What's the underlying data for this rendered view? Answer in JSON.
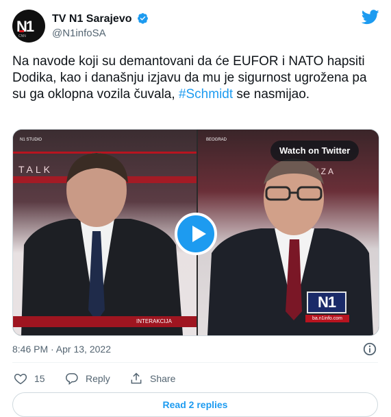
{
  "account": {
    "name": "TV N1 Sarajevo",
    "handle": "@N1infoSA",
    "avatar_text": "N1",
    "avatar_subtext": "CNN"
  },
  "tweet": {
    "text_before": "Na navode koji su demantovani da će EUFOR i NATO hapsiti Dodika, kao i današnju izjavu da mu je sigurnost ugrožena pa su ga oklopna vozila čuvala, ",
    "hashtag": "#Schmidt",
    "text_after": " se nasmijao."
  },
  "media": {
    "watch_label": "Watch on Twitter",
    "left_label": "N1 STUDIO",
    "right_label": "BEOGRAD",
    "left_wall": "TALK",
    "right_wall": "ANALIZA",
    "lower_band": "INTERAKCIJA",
    "badge": "N1",
    "badge_url": "ba.n1info.com"
  },
  "meta": {
    "timestamp": "8:46 PM · Apr 13, 2022"
  },
  "actions": {
    "likes": "15",
    "reply_label": "Reply",
    "share_label": "Share"
  },
  "replies_button": "Read 2 replies",
  "colors": {
    "accent": "#1d9bf0",
    "text": "#0f1419",
    "secondary": "#536471"
  }
}
